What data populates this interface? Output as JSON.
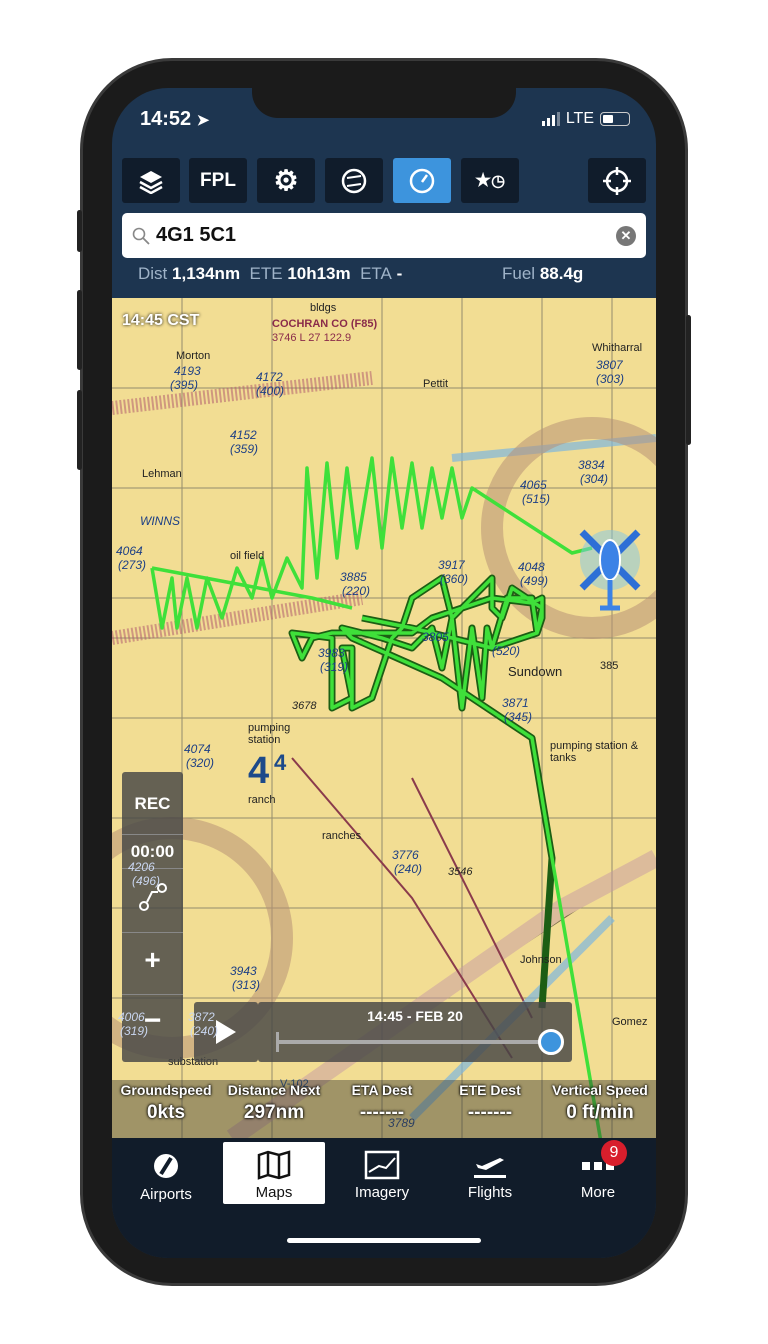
{
  "status": {
    "time": "14:52",
    "network": "LTE"
  },
  "toolbar": {
    "fpl_label": "FPL",
    "buttons": [
      "layers-icon",
      "fpl",
      "gear-icon",
      "hsi-icon",
      "gauge-icon",
      "star-clock-icon",
      "locate-icon"
    ],
    "active": "gauge-icon"
  },
  "search": {
    "value": "4G1 5C1"
  },
  "info": {
    "dist_label": "Dist",
    "dist": "1,134nm",
    "ete_label": "ETE",
    "ete": "10h13m",
    "eta_label": "ETA",
    "eta": "-",
    "fuel_label": "Fuel",
    "fuel": "88.4g"
  },
  "map": {
    "time_label": "14:45 CST",
    "labels": [
      "COCHRAN CO (F85)",
      "3746 L 27 122.9",
      "Morton",
      "4193",
      "(395)",
      "4172",
      "(400)",
      "bldgs",
      "Pettit",
      "Whitharral",
      "3807",
      "(303)",
      "4152",
      "(359)",
      "Lehman",
      "WINNS",
      "4064",
      "(273)",
      "oil field",
      "3834",
      "(304)",
      "4065",
      "(515)",
      "3917",
      "(360)",
      "3885",
      "(220)",
      "4048",
      "(499)",
      "3983",
      "(319)",
      "3805",
      "(520)",
      "Sundown",
      "3871",
      "(345)",
      "3678",
      "pumping station",
      "4074",
      "(320)",
      "4",
      "4",
      "ranch",
      "ranches",
      "pumping station & tanks",
      "3776",
      "(240)",
      "3546",
      "Johnson",
      "Gomez",
      "4206",
      "(496)",
      "3943",
      "(313)",
      "4006",
      "(319)",
      "3872",
      "(240)",
      "substation",
      "3789",
      "V-102",
      "385"
    ]
  },
  "rec": {
    "label": "REC",
    "timer": "00:00"
  },
  "timeline": {
    "label": "14:45 - FEB 20",
    "position": 1.0
  },
  "instruments": [
    {
      "label": "Groundspeed",
      "value": "0kts"
    },
    {
      "label": "Distance Next",
      "value": "297nm"
    },
    {
      "label": "ETA Dest",
      "value": "-------"
    },
    {
      "label": "ETE Dest",
      "value": "-------"
    },
    {
      "label": "Vertical Speed",
      "value": "0 ft/min"
    }
  ],
  "tabs": [
    {
      "label": "Airports",
      "icon": "airports-icon"
    },
    {
      "label": "Maps",
      "icon": "map-icon",
      "active": true
    },
    {
      "label": "Imagery",
      "icon": "imagery-icon"
    },
    {
      "label": "Flights",
      "icon": "plane-takeoff-icon"
    },
    {
      "label": "More",
      "icon": "more-icon",
      "badge": "9"
    }
  ],
  "colors": {
    "accent": "#3d94dd",
    "track": "#3fe03a",
    "chart": "#f2dd93",
    "badge": "#d81e2c"
  }
}
